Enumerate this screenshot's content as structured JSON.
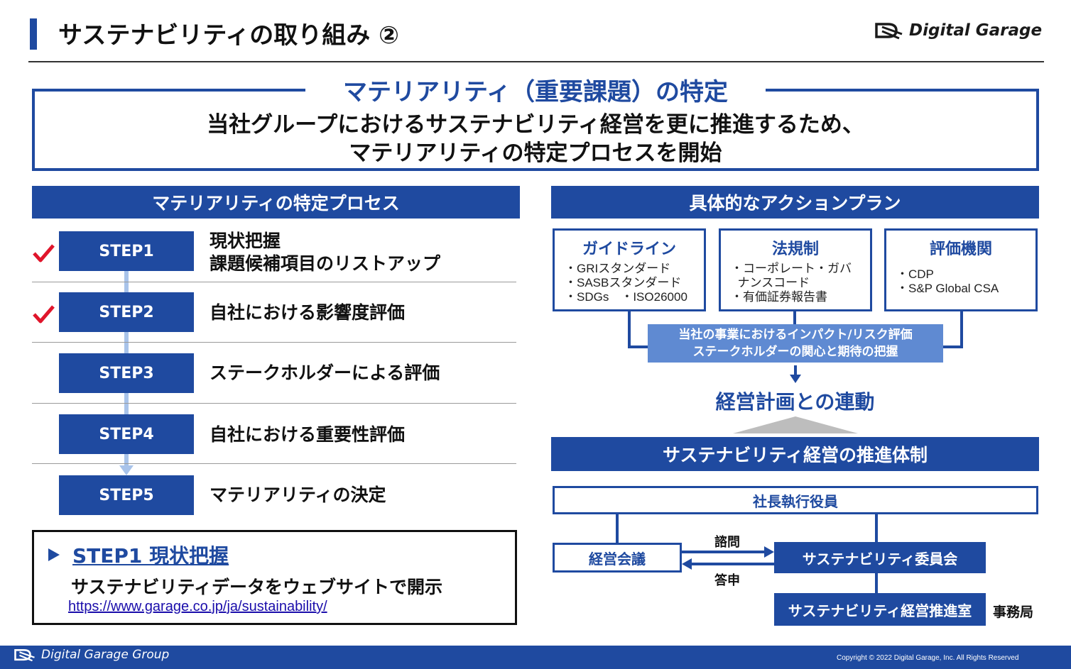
{
  "header": {
    "title": "サステナビリティの取り組み ②",
    "logo_text": "Digital Garage"
  },
  "intro": {
    "heading": "マテリアリティ（重要課題）の特定",
    "line1": "当社グループにおけるサステナビリティ経営を更に推進するため、",
    "line2": "マテリアリティの特定プロセスを開始"
  },
  "process": {
    "header": "マテリアリティの特定プロセス",
    "steps": [
      {
        "label": "STEP1",
        "line1": "現状把握",
        "line2": "課題候補項目のリストアップ",
        "checked": true
      },
      {
        "label": "STEP2",
        "line1": "自社における影響度評価",
        "checked": true
      },
      {
        "label": "STEP3",
        "line1": "ステークホルダーによる評価",
        "checked": false
      },
      {
        "label": "STEP4",
        "line1": "自社における重要性評価",
        "checked": false
      },
      {
        "label": "STEP5",
        "line1": "マテリアリティの決定",
        "checked": false
      }
    ],
    "check_color": "#e0152b"
  },
  "step1_detail": {
    "title": "STEP1 現状把握",
    "description": "サステナビリティデータをウェブサイトで開示",
    "link": "https://www.garage.co.jp/ja/sustainability/"
  },
  "action_plan": {
    "header": "具体的なアクションプラン",
    "cards": [
      {
        "title": "ガイドライン",
        "items": [
          "・GRIスタンダード",
          "・SASBスタンダード",
          "・SDGs　・ISO26000"
        ]
      },
      {
        "title": "法規制",
        "items": [
          "・コーポレート・ガバ",
          "  ナンスコード",
          "・有価証券報告書"
        ]
      },
      {
        "title": "評価機関",
        "items": [
          "・CDP",
          "・S&P Global CSA"
        ]
      }
    ],
    "evaluation_line1": "当社の事業におけるインパクト/リスク評価",
    "evaluation_line2": "ステークホルダーの関心と期待の把握",
    "plan_link": "経営計画との連動"
  },
  "system": {
    "header": "サステナビリティ経営の推進体制",
    "ceo": "社長執行役員",
    "management_meeting": "経営会議",
    "committee": "サステナビリティ委員会",
    "office": "サステナビリティ経営推進室",
    "secretariat": "事務局",
    "consult": "諮問",
    "report": "答申"
  },
  "footer": {
    "group_name": "Digital Garage Group",
    "copyright": "Copyright © 2022 Digital Garage, Inc. All Rights Reserved"
  },
  "colors": {
    "brand_navy": "#1f4aa0",
    "light_blue": "#5f8ad2",
    "step_line": "#a8c3ea"
  }
}
